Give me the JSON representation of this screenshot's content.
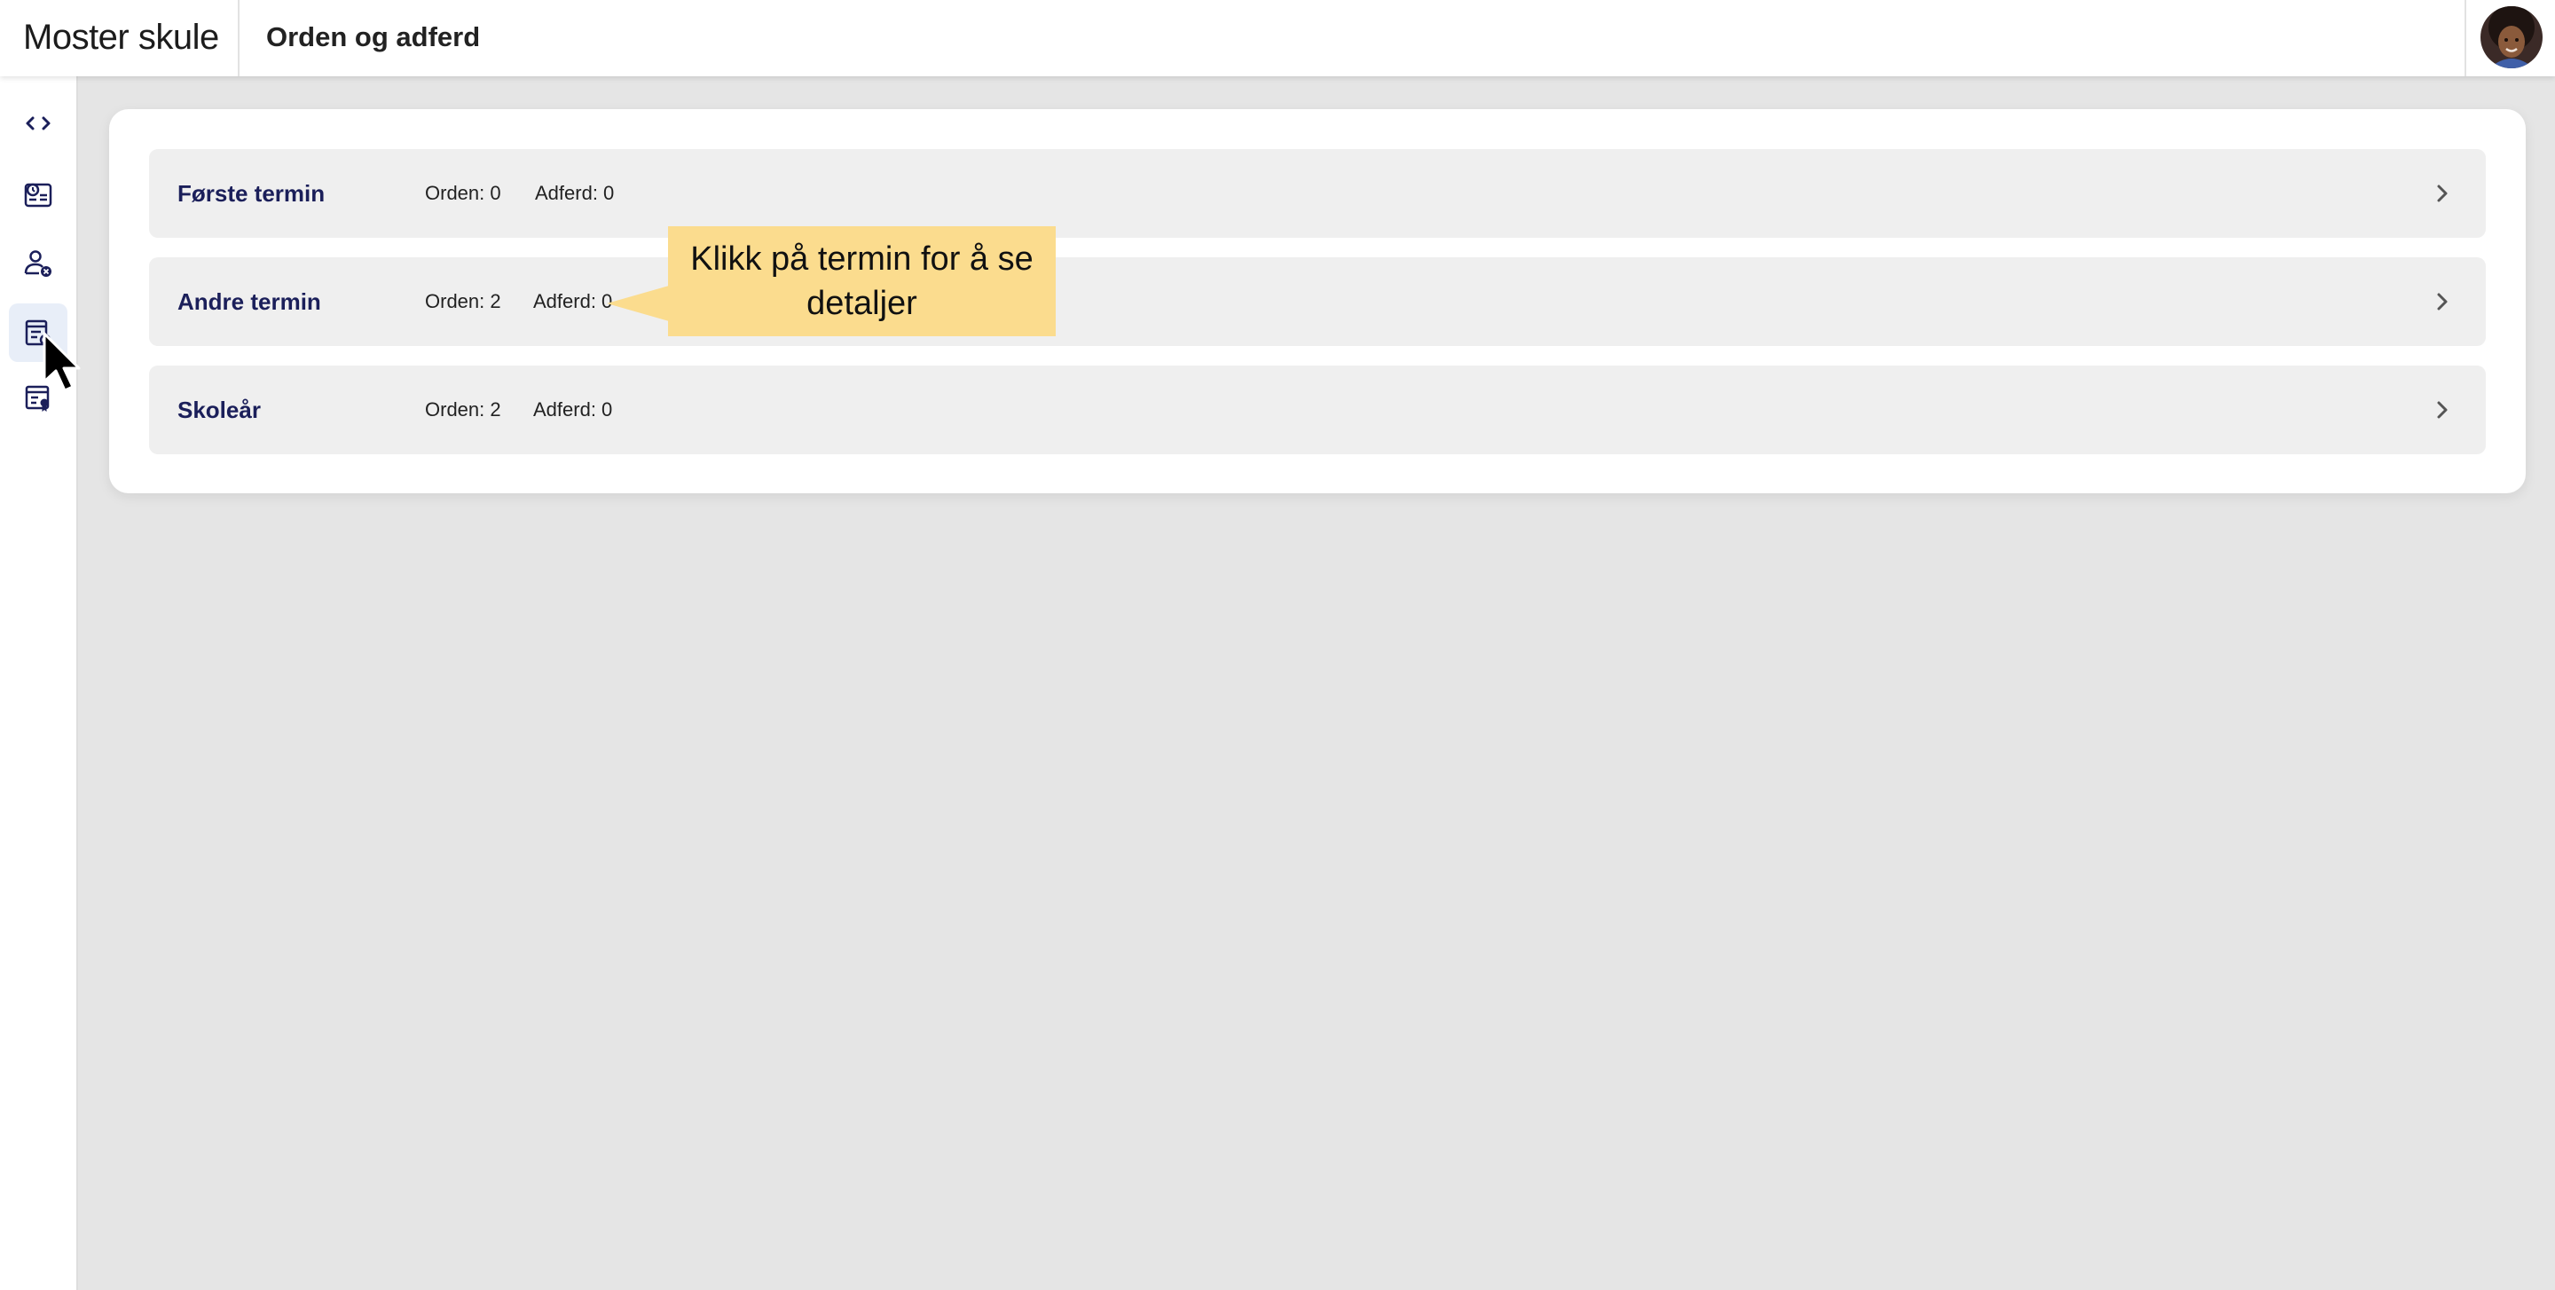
{
  "app": {
    "brand": "Moster skule",
    "page_title": "Orden og adferd"
  },
  "sidebar": {
    "items": [
      {
        "icon": "expand-collapse-icon",
        "active": false
      },
      {
        "icon": "dashboard-icon",
        "active": false
      },
      {
        "icon": "absence-icon",
        "active": false
      },
      {
        "icon": "conduct-report-icon",
        "active": true
      },
      {
        "icon": "certificate-icon",
        "active": false
      }
    ]
  },
  "terms": [
    {
      "name": "Første termin",
      "orden": "Orden: 0",
      "adferd": "Adferd: 0"
    },
    {
      "name": "Andre termin",
      "orden": "Orden: 2",
      "adferd": "Adferd: 0"
    },
    {
      "name": "Skoleår",
      "orden": "Orden: 2",
      "adferd": "Adferd: 0"
    }
  ],
  "tooltip": {
    "text": "Klikk på termin for å se detaljer"
  },
  "colors": {
    "accent_text": "#1b1f5a",
    "tooltip_bg": "#fbdc8e",
    "background": "#e5e5e5"
  }
}
